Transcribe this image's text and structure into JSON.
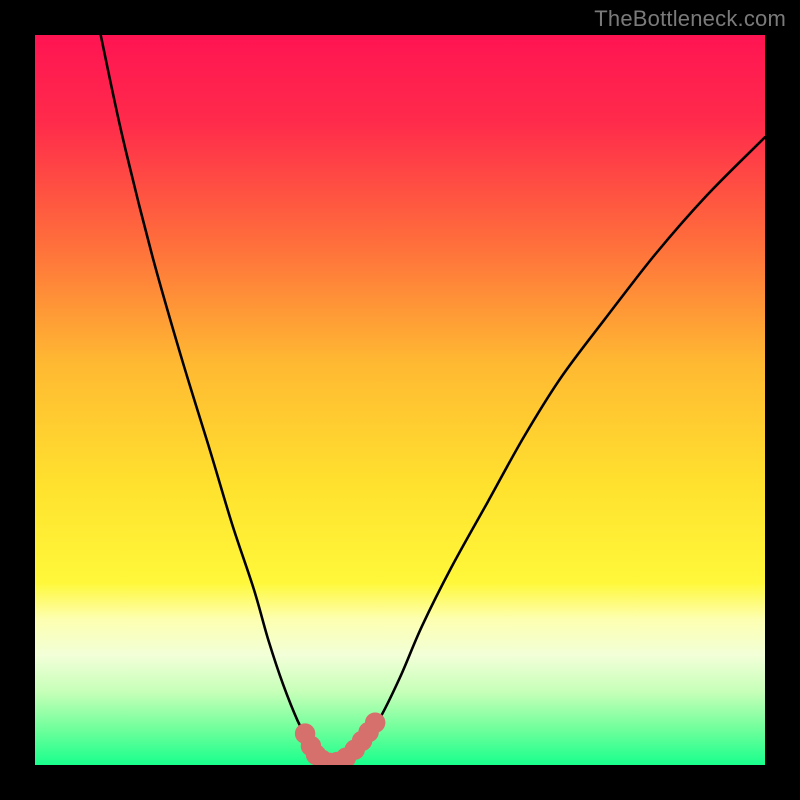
{
  "watermark": "TheBottleneck.com",
  "colors": {
    "frame": "#000000",
    "curve": "#000000",
    "marker_fill": "#d6706c",
    "marker_stroke": "#d6706c",
    "gradient_stops": [
      {
        "offset": "0%",
        "color": "#ff1452"
      },
      {
        "offset": "12%",
        "color": "#ff2b4b"
      },
      {
        "offset": "28%",
        "color": "#ff6c3c"
      },
      {
        "offset": "45%",
        "color": "#ffb932"
      },
      {
        "offset": "62%",
        "color": "#ffe22e"
      },
      {
        "offset": "75%",
        "color": "#fff83a"
      },
      {
        "offset": "80%",
        "color": "#fdffb0"
      },
      {
        "offset": "85%",
        "color": "#f2ffd8"
      },
      {
        "offset": "90%",
        "color": "#c6ffb8"
      },
      {
        "offset": "95%",
        "color": "#71ff9c"
      },
      {
        "offset": "100%",
        "color": "#18ff8c"
      }
    ]
  },
  "chart_data": {
    "type": "line",
    "title": "",
    "xlabel": "",
    "ylabel": "",
    "xlim": [
      0,
      100
    ],
    "ylim": [
      0,
      100
    ],
    "series": [
      {
        "name": "bottleneck-curve",
        "x": [
          9,
          12,
          16,
          20,
          24,
          27,
          30,
          32,
          34,
          36,
          37.5,
          39,
          40.5,
          42,
          44,
          47,
          50,
          53,
          57,
          62,
          67,
          72,
          78,
          85,
          92,
          100
        ],
        "y": [
          100,
          86,
          70,
          56,
          43,
          33,
          24,
          17,
          11,
          6,
          3.2,
          1.2,
          0.3,
          0.7,
          2.2,
          6,
          12,
          19,
          27,
          36,
          45,
          53,
          61,
          70,
          78,
          86
        ]
      }
    ],
    "markers": {
      "name": "highlight-points",
      "points": [
        {
          "x": 37.0,
          "y": 4.3
        },
        {
          "x": 37.8,
          "y": 2.6
        },
        {
          "x": 38.5,
          "y": 1.4
        },
        {
          "x": 39.3,
          "y": 0.7
        },
        {
          "x": 40.3,
          "y": 0.3
        },
        {
          "x": 41.4,
          "y": 0.4
        },
        {
          "x": 42.6,
          "y": 1.0
        },
        {
          "x": 43.8,
          "y": 2.1
        },
        {
          "x": 44.8,
          "y": 3.3
        },
        {
          "x": 45.7,
          "y": 4.5
        },
        {
          "x": 46.6,
          "y": 5.8
        }
      ],
      "radius": 1.35
    }
  }
}
